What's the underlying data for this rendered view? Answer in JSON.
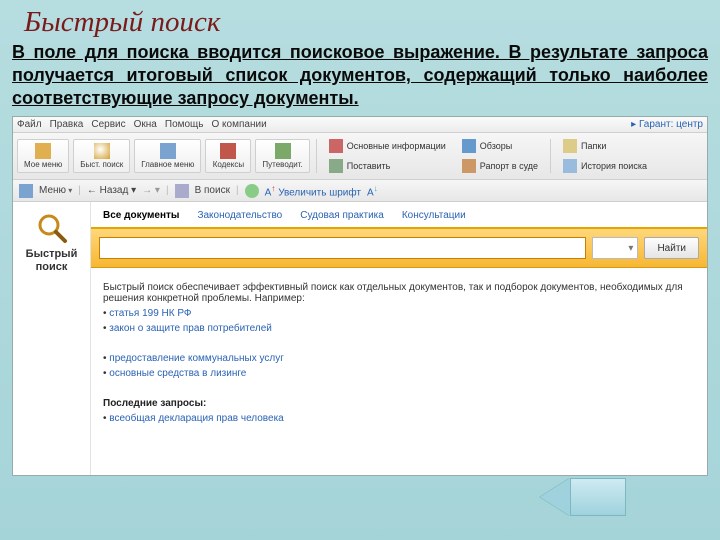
{
  "slide": {
    "title": "Быстрый поиск",
    "description": "В поле для поиска вводится поисковое выражение. В результате запроса получается итоговый список документов, содержащий только наиболее соответствующие запросу документы."
  },
  "menubar": {
    "items": [
      "Файл",
      "Правка",
      "Сервис",
      "Окна",
      "Помощь",
      "О компании"
    ],
    "right": "Гарант: центр"
  },
  "toolbar": [
    {
      "label": "Мое меню",
      "icon": "#e0b050"
    },
    {
      "label": "Быст. поиск",
      "icon": "#d4a030"
    },
    {
      "label": "Главное меню",
      "icon": "#7aa3d0"
    },
    {
      "label": "Кодексы",
      "icon": "#c0574a"
    },
    {
      "label": "Путеводит.",
      "icon": "#7aa96a"
    }
  ],
  "toolbar_flat": [
    {
      "label": "Основные информации",
      "icon": "#c66"
    },
    {
      "label": "Поставить",
      "icon": "#8a8"
    },
    {
      "label": "Обзоры",
      "icon": "#69c"
    },
    {
      "label": "Рапорт в суде",
      "icon": "#c96"
    },
    {
      "label": "Папки",
      "icon": "#dc8"
    },
    {
      "label": "История поиска",
      "icon": "#9bd"
    }
  ],
  "toolbar2": {
    "menu": "Меню",
    "back": "Назад",
    "panel": "В поиск",
    "zoom": "Увеличить шрифт"
  },
  "side": {
    "line1": "Быстрый",
    "line2": "поиск"
  },
  "tabs": [
    "Все документы",
    "Законодательство",
    "Судовая практика",
    "Консультации"
  ],
  "search": {
    "value": "",
    "placeholder": "",
    "combo": "▾",
    "find": "Найти"
  },
  "body": {
    "intro": "Быстрый поиск обеспечивает эффективный поиск как отдельных документов, так и подборок документов, необходимых для решения конкретной проблемы. Например:",
    "ex1": "статья 199 НК РФ",
    "ex2": "закон о защите прав потребителей",
    "ex3": "предоставление коммунальных услуг",
    "ex4": "основные средства в лизинге",
    "recent_label": "Последние запросы:",
    "recent_item": "всеобщая декларация прав человека"
  }
}
